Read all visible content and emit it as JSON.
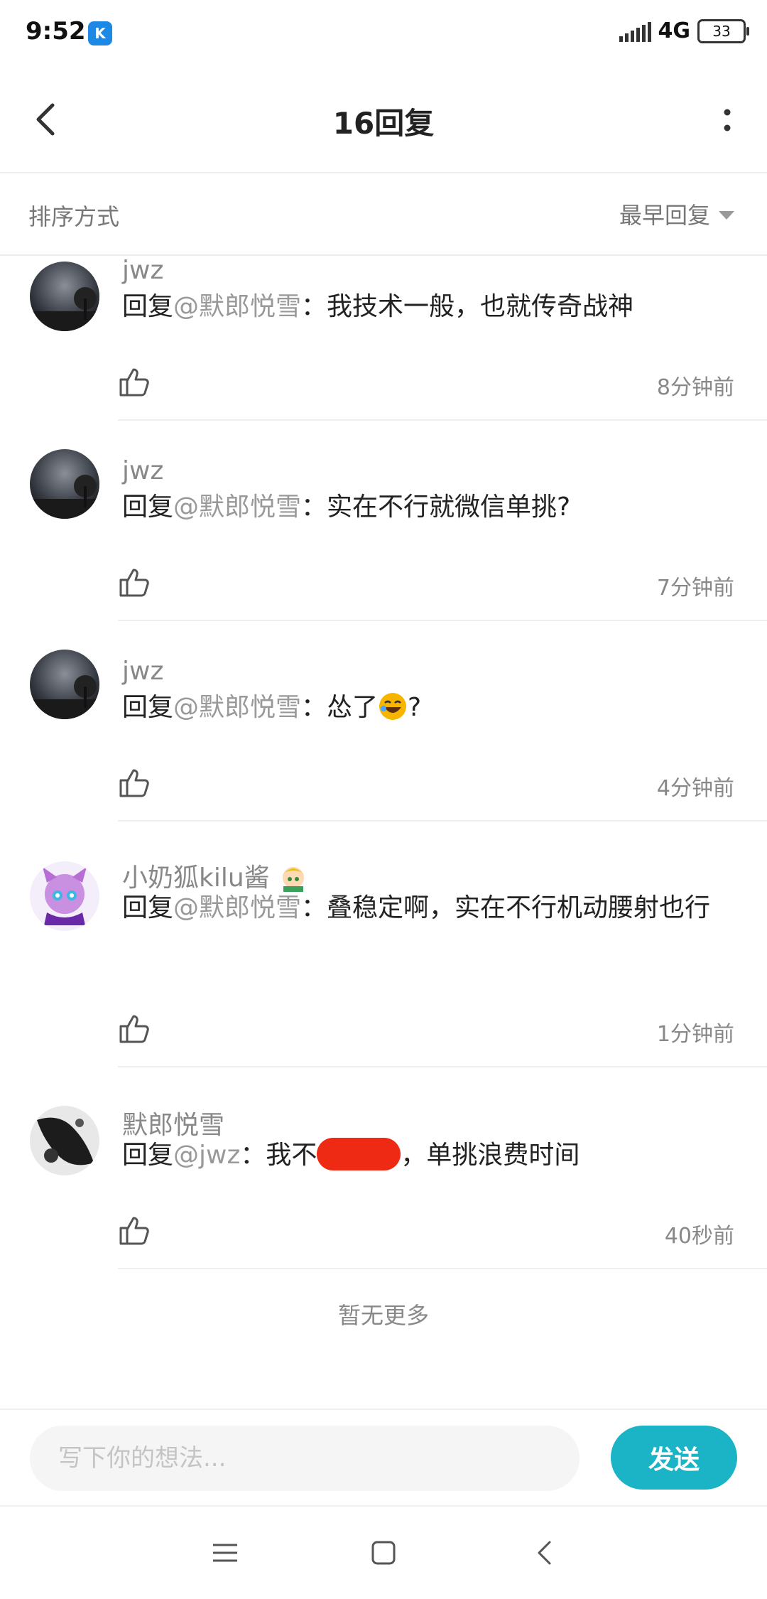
{
  "status_bar": {
    "time": "9:52",
    "network": "4G",
    "battery": "33"
  },
  "header": {
    "title": "16回复"
  },
  "sort": {
    "label": "排序方式",
    "selected": "最早回复"
  },
  "comments": [
    {
      "user": "jwz",
      "reply_prefix": "回复",
      "mention": "@默郎悦雪",
      "text": "：我技术一般，也就传奇战神",
      "time": "8分钟前"
    },
    {
      "user": "jwz",
      "reply_prefix": "回复",
      "mention": "@默郎悦雪",
      "text": "：实在不行就微信单挑?",
      "time": "7分钟前"
    },
    {
      "user": "jwz",
      "reply_prefix": "回复",
      "mention": "@默郎悦雪",
      "text": "：怂了",
      "text_after": "?",
      "time": "4分钟前"
    },
    {
      "user": "小奶狐kilu酱",
      "reply_prefix": "回复",
      "mention": "@默郎悦雪",
      "text": "：叠稳定啊，实在不行机动腰射也行",
      "time": "1分钟前"
    },
    {
      "user": "默郎悦雪",
      "reply_prefix": "回复",
      "mention": "@jwz",
      "text": "：我不",
      "text_after": "，单挑浪费时间",
      "time": "40秒前"
    }
  ],
  "no_more": "暂无更多",
  "input": {
    "placeholder": "写下你的想法..."
  },
  "send_label": "发送",
  "colors": {
    "accent": "#1ab4c6",
    "redaction": "#ee2a15"
  },
  "icons": [
    "back-icon",
    "more-icon",
    "sort-caret-icon",
    "thumbs-up-icon",
    "menu-icon",
    "home-icon",
    "nav-back-icon"
  ]
}
